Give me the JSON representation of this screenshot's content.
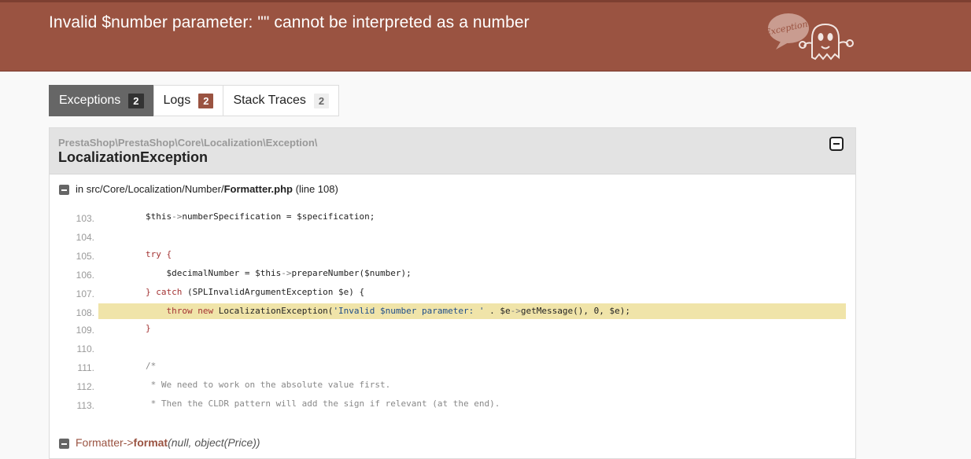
{
  "header": {
    "title": "Invalid $number parameter: \"\" cannot be interpreted as a number",
    "logo_bubble_text": "Exception!"
  },
  "tabs": [
    {
      "label": "Exceptions",
      "count": "2"
    },
    {
      "label": "Logs",
      "count": "2"
    },
    {
      "label": "Stack Traces",
      "count": "2"
    }
  ],
  "exception": {
    "namespace": "PrestaShop\\PrestaShop\\Core\\Localization\\Exception\\",
    "class_name": "LocalizationException",
    "file_prefix": "in src/Core/Localization/Number/",
    "file_name": "Formatter.php",
    "line_info": "(line 108)"
  },
  "code_lines": [
    {
      "num": "103.",
      "indent": 0,
      "parts": [
        {
          "t": "$this",
          "c": ""
        },
        {
          "t": "->",
          "c": "op"
        },
        {
          "t": "numberSpecification = $specification;",
          "c": ""
        }
      ]
    },
    {
      "num": "104.",
      "indent": 0,
      "parts": []
    },
    {
      "num": "105.",
      "indent": 0,
      "parts": [
        {
          "t": "try {",
          "c": "kw"
        }
      ]
    },
    {
      "num": "106.",
      "indent": 1,
      "parts": [
        {
          "t": "$decimalNumber = $this",
          "c": ""
        },
        {
          "t": "->",
          "c": "op"
        },
        {
          "t": "prepareNumber($number);",
          "c": ""
        }
      ]
    },
    {
      "num": "107.",
      "indent": 0,
      "parts": [
        {
          "t": "} catch ",
          "c": "kw"
        },
        {
          "t": "(SPLInvalidArgumentException $e) {",
          "c": ""
        }
      ]
    },
    {
      "num": "108.",
      "indent": 1,
      "hl": true,
      "parts": [
        {
          "t": "throw new ",
          "c": "kw"
        },
        {
          "t": "LocalizationException(",
          "c": ""
        },
        {
          "t": "'Invalid $number parameter: '",
          "c": "st"
        },
        {
          "t": " . $e",
          "c": ""
        },
        {
          "t": "->",
          "c": "op"
        },
        {
          "t": "getMessage(), 0, $e);",
          "c": ""
        }
      ]
    },
    {
      "num": "109.",
      "indent": 0,
      "parts": [
        {
          "t": "}",
          "c": "kw"
        }
      ]
    },
    {
      "num": "110.",
      "indent": 0,
      "parts": []
    },
    {
      "num": "111.",
      "indent": 0,
      "parts": [
        {
          "t": "/*",
          "c": "cm"
        }
      ]
    },
    {
      "num": "112.",
      "indent": 0,
      "parts": [
        {
          "t": " * We need to work on the absolute value first.",
          "c": "cm"
        }
      ]
    },
    {
      "num": "113.",
      "indent": 0,
      "parts": [
        {
          "t": " * Then the CLDR pattern will add the sign if relevant (at the end).",
          "c": "cm"
        }
      ]
    }
  ],
  "next_trace": {
    "class_text": "Formatter",
    "arrow": "->",
    "method": "format",
    "args": "(null, object(Price))"
  }
}
